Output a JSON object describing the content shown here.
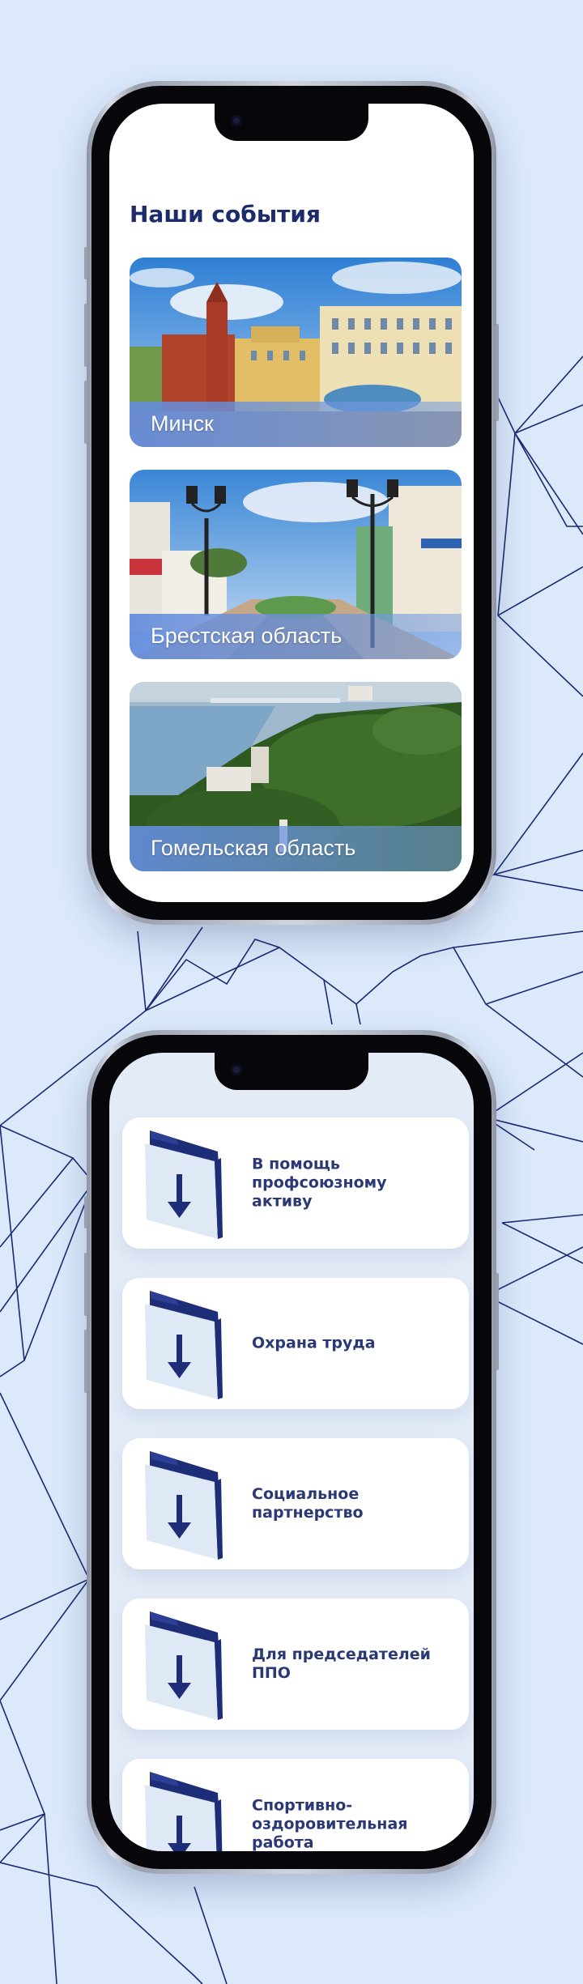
{
  "events_screen": {
    "title": "Наши события",
    "cards": [
      {
        "label": "Минск"
      },
      {
        "label": "Брестская область"
      },
      {
        "label": "Гомельская область"
      }
    ]
  },
  "documents_screen": {
    "items": [
      {
        "label": "В помощь\nпрофсоюзному\nактиву",
        "icon": "folder-download-icon"
      },
      {
        "label": "Охрана труда",
        "icon": "folder-download-icon"
      },
      {
        "label": "Социальное\nпартнерство",
        "icon": "folder-download-icon"
      },
      {
        "label": "Для председателей\nППО",
        "icon": "folder-download-icon"
      },
      {
        "label": "Спортивно-\nоздоровительная\nработа",
        "icon": "folder-download-icon"
      }
    ]
  },
  "colors": {
    "background": "#dbe9fb",
    "accent_navy": "#1c2b6b",
    "line_color": "#1a2a72",
    "card_caption_blue": "#6f93dc"
  }
}
